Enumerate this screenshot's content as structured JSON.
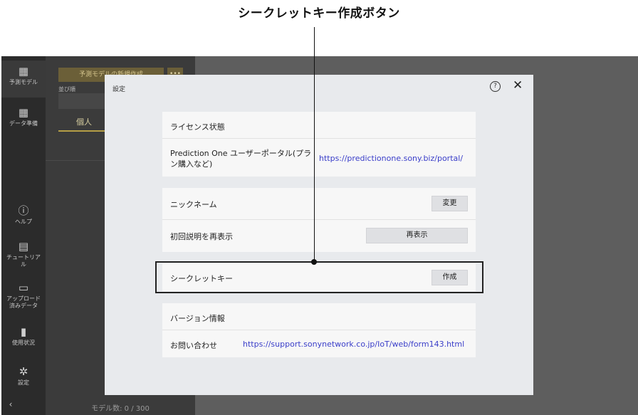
{
  "annotation": {
    "title": "シークレットキー作成ボタン"
  },
  "sidebar": {
    "items": [
      {
        "label": "予測モデル",
        "icon": "model-icon"
      },
      {
        "label": "データ準備",
        "icon": "data-prep-icon"
      },
      {
        "label": "ヘルプ",
        "icon": "help-icon"
      },
      {
        "label": "チュートリアル",
        "icon": "tutorial-icon"
      },
      {
        "label": "アップロード済みデータ",
        "icon": "folder-icon"
      },
      {
        "label": "使用状況",
        "icon": "usage-chart-icon"
      },
      {
        "label": "設定",
        "icon": "gear-icon"
      }
    ],
    "collapse_icon": "chevron-left-icon"
  },
  "model_panel": {
    "new_button": "予測モデルの新規作成",
    "more_button": "•••",
    "sort_label": "並び順",
    "tab_label": "個人",
    "count_text": "モデル数: 0 / 300"
  },
  "dialog": {
    "title": "設定",
    "help_glyph": "?",
    "close_glyph": "✕",
    "sections": {
      "license": {
        "status_label": "ライセンス状態",
        "portal_label": "Prediction One ユーザーポータル(プラン購入など)",
        "portal_url": "https://predictionone.sony.biz/portal/"
      },
      "profile": {
        "nickname_label": "ニックネーム",
        "change_button": "変更",
        "intro_label": "初回説明を再表示",
        "redisplay_button": "再表示"
      },
      "secret": {
        "label": "シークレットキー",
        "create_button": "作成"
      },
      "info": {
        "version_label": "バージョン情報",
        "contact_label": "お問い合わせ",
        "contact_url": "https://support.sonynetwork.co.jp/IoT/web/form143.html"
      }
    }
  },
  "colors": {
    "link": "#3a3ec9",
    "accent": "#b59e46",
    "overlay": "#5e5e5e"
  }
}
